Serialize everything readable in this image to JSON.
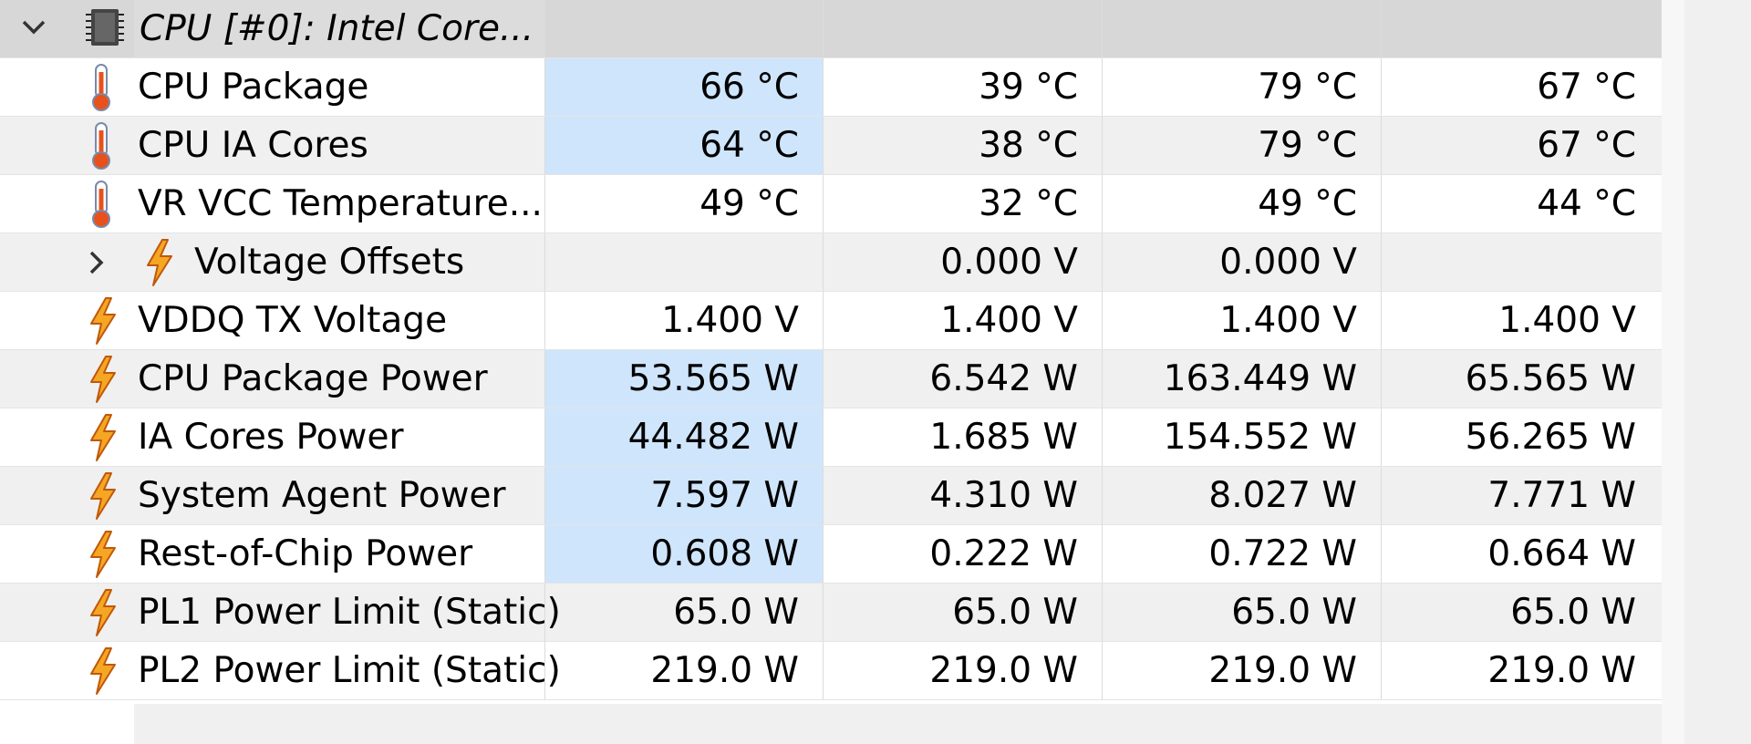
{
  "group": {
    "label": "CPU [#0]: Intel Core...",
    "icon": "cpu-chip-icon",
    "expand_icon": "chevron-down-icon"
  },
  "rows": [
    {
      "label": "CPU Package",
      "icon": "thermometer-icon",
      "values": [
        "66 °C",
        "39 °C",
        "79 °C",
        "67 °C"
      ],
      "highlight": true
    },
    {
      "label": "CPU IA Cores",
      "icon": "thermometer-icon",
      "values": [
        "64 °C",
        "38 °C",
        "79 °C",
        "67 °C"
      ],
      "highlight": true
    },
    {
      "label": "VR VCC Temperature...",
      "icon": "thermometer-icon",
      "values": [
        "49 °C",
        "32 °C",
        "49 °C",
        "44 °C"
      ],
      "highlight": false
    },
    {
      "label": "Voltage Offsets",
      "icon": "lightning-icon",
      "values": [
        "",
        "0.000 V",
        "0.000 V",
        ""
      ],
      "highlight": false,
      "collapsible": true,
      "expand_icon": "chevron-right-icon"
    },
    {
      "label": "VDDQ TX Voltage",
      "icon": "lightning-icon",
      "values": [
        "1.400 V",
        "1.400 V",
        "1.400 V",
        "1.400 V"
      ],
      "highlight": false
    },
    {
      "label": "CPU Package Power",
      "icon": "lightning-icon",
      "values": [
        "53.565 W",
        "6.542 W",
        "163.449 W",
        "65.565 W"
      ],
      "highlight": true
    },
    {
      "label": "IA Cores Power",
      "icon": "lightning-icon",
      "values": [
        "44.482 W",
        "1.685 W",
        "154.552 W",
        "56.265 W"
      ],
      "highlight": true
    },
    {
      "label": "System Agent Power",
      "icon": "lightning-icon",
      "values": [
        "7.597 W",
        "4.310 W",
        "8.027 W",
        "7.771 W"
      ],
      "highlight": true
    },
    {
      "label": "Rest-of-Chip Power",
      "icon": "lightning-icon",
      "values": [
        "0.608 W",
        "0.222 W",
        "0.722 W",
        "0.664 W"
      ],
      "highlight": true
    },
    {
      "label": "PL1 Power Limit (Static)",
      "icon": "lightning-icon",
      "values": [
        "65.0 W",
        "65.0 W",
        "65.0 W",
        "65.0 W"
      ],
      "highlight": false
    },
    {
      "label": "PL2 Power Limit (Static)",
      "icon": "lightning-icon",
      "values": [
        "219.0 W",
        "219.0 W",
        "219.0 W",
        "219.0 W"
      ],
      "highlight": false
    }
  ],
  "colors": {
    "highlight": "#cfe5fb",
    "group_bg": "#d7d7d7",
    "alt_row": "#f0f0f0",
    "thermo_red": "#e8511c",
    "bolt_orange": "#f5a623"
  }
}
